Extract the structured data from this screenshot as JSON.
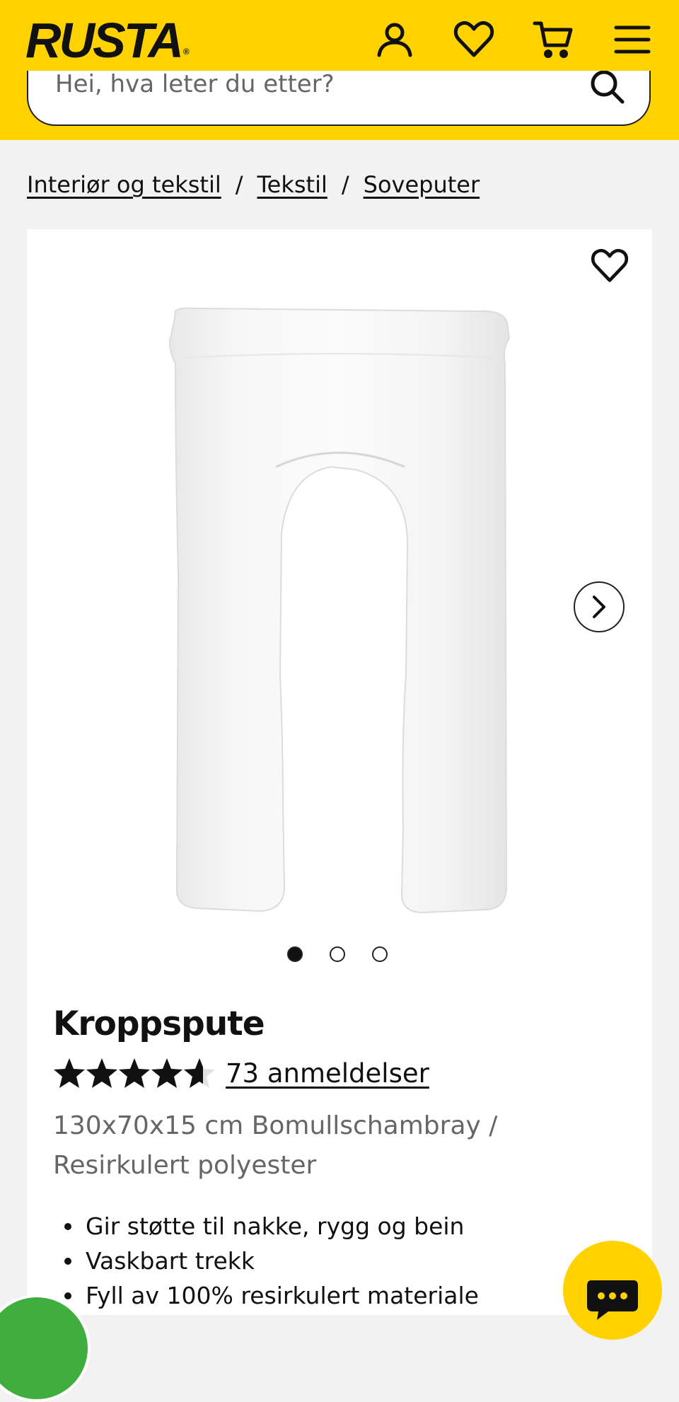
{
  "header": {
    "logo_text": "RUSTA",
    "logo_mark": "®",
    "icons": [
      "user-icon",
      "heart-icon",
      "cart-icon",
      "menu-icon"
    ],
    "brand_color": "#ffd200"
  },
  "search": {
    "placeholder": "Hei, hva leter du etter?",
    "icon": "search-icon"
  },
  "breadcrumb": {
    "items": [
      "Interiør og tekstil",
      "Tekstil",
      "Soveputer"
    ],
    "separator": "/"
  },
  "product": {
    "image_alt": "Kroppspute",
    "carousel": {
      "total": 3,
      "active": 1
    },
    "title": "Kroppspute",
    "rating": {
      "value": 4.6,
      "max": 5
    },
    "reviews_label": "73 anmeldelser",
    "variant": "130x70x15 cm Bomullschambray / Resirkulert polyester",
    "features": [
      "Gir støtte til nakke, rygg og bein",
      "Vaskbart trekk",
      "Fyll av 100% resirkulert materiale"
    ]
  },
  "chat": {
    "icon": "chat-icon"
  }
}
